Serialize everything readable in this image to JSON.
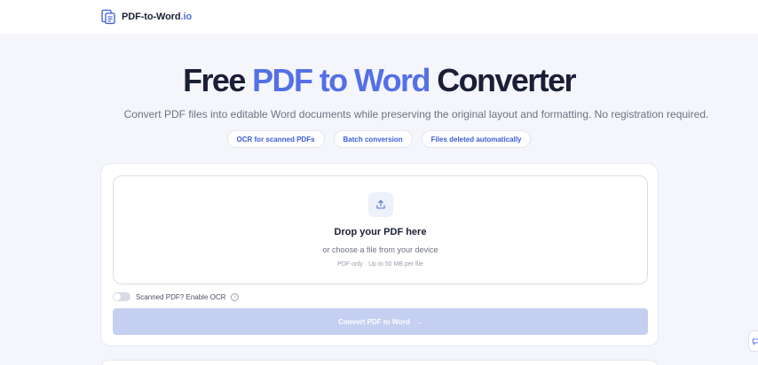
{
  "header": {
    "brand_main": "PDF-to-Word",
    "brand_tld": ".io",
    "logo_icon": "pdf-document-icon"
  },
  "hero": {
    "title_start": "Free ",
    "title_accent": "PDF to Word",
    "title_end": " Converter",
    "subtitle": "Convert PDF files into editable Word documents while preserving the original layout and formatting. No registration required."
  },
  "features": [
    {
      "label": "OCR for scanned PDFs"
    },
    {
      "label": "Batch conversion"
    },
    {
      "label": "Files deleted automatically"
    }
  ],
  "upload": {
    "icon": "upload-icon",
    "title": "Drop your PDF here",
    "subtitle": "or choose a file from your device",
    "limits": "PDF only · Up to 50 MB per file"
  },
  "ocr": {
    "label": "Scanned PDF? Enable OCR",
    "enabled": false,
    "info_glyph": "i"
  },
  "convert": {
    "label": "Convert PDF to Word",
    "arrow": "→",
    "disabled": true
  },
  "colors": {
    "accent": "#5470e6",
    "pill_text": "#3b5bdb",
    "button_disabled": "#c5cff1",
    "background": "#f4f6fb"
  }
}
